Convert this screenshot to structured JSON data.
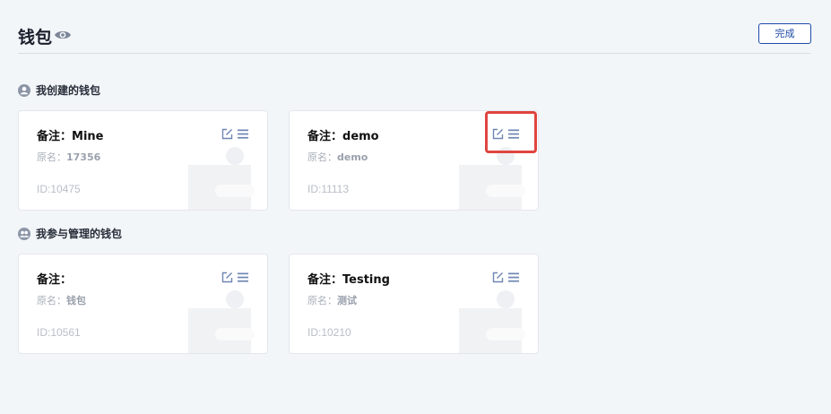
{
  "header": {
    "title": "钱包",
    "done_label": "完成"
  },
  "sections": [
    {
      "title": "我创建的钱包",
      "cards": [
        {
          "note_prefix": "备注：",
          "note": "Mine",
          "orig_prefix": "原名：",
          "orig": "17356",
          "id_text": "ID:10475"
        },
        {
          "note_prefix": "备注：",
          "note": "demo",
          "orig_prefix": "原名：",
          "orig": "demo",
          "id_text": "ID:11113"
        }
      ]
    },
    {
      "title": "我参与管理的钱包",
      "cards": [
        {
          "note_prefix": "备注：",
          "note": "",
          "orig_prefix": "原名：",
          "orig": "钱包",
          "id_text": "ID:10561"
        },
        {
          "note_prefix": "备注：",
          "note": "Testing",
          "orig_prefix": "原名：",
          "orig": "测试",
          "id_text": "ID:10210"
        }
      ]
    }
  ],
  "colors": {
    "accent": "#1d4aa8",
    "highlight": "#e0453f",
    "background": "#f3f6f9",
    "icon": "#6f86b3"
  }
}
